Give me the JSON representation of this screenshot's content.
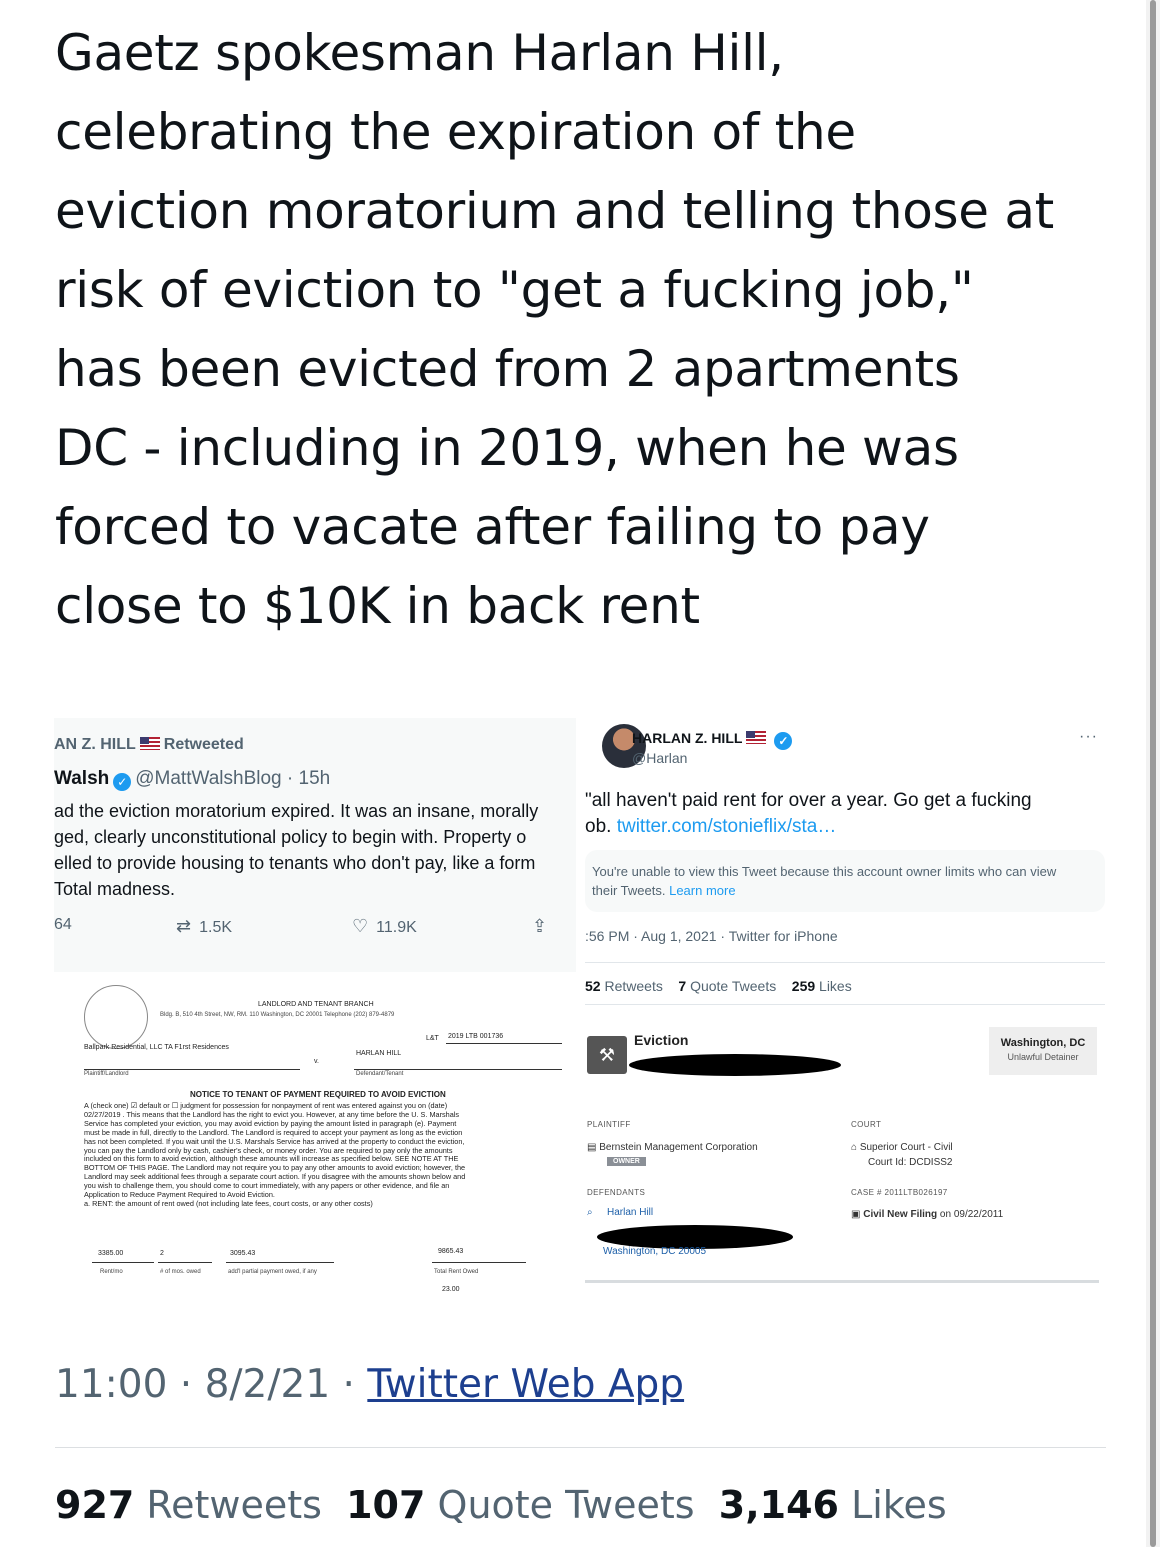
{
  "tweet": {
    "lines": [
      "Gaetz spokesman Harlan Hill,",
      "celebrating the expiration of the",
      "eviction moratorium and telling those at",
      "risk of eviction to \"get a fucking job,\"",
      "has been evicted from 2 apartments",
      "DC - including in 2019, when he was",
      "forced to vacate after failing to pay",
      "close to $10K in back rent"
    ],
    "time": "11:00",
    "date": "8/2/21",
    "source": "Twitter Web App",
    "retweets_count": "927",
    "retweets_label": "Retweets",
    "quotes_count": "107",
    "quotes_label": "Quote Tweets",
    "likes_count": "3,146",
    "likes_label": "Likes"
  },
  "left_screenshot": {
    "retweet_by": "AN Z. HILL",
    "retweeted_label": "Retweeted",
    "author_name": "Walsh",
    "author_handle": "@MattWalshBlog",
    "author_time": "· 15h",
    "body": [
      "ad the eviction moratorium expired. It was an insane, morally",
      "ged, clearly unconstitutional policy to begin with. Property o",
      "elled to provide housing to tenants who don't pay, like a form",
      " Total madness."
    ],
    "replies": "64",
    "retweets": "1.5K",
    "likes": "11.9K"
  },
  "document": {
    "branch": "LANDLORD AND TENANT BRANCH",
    "address": "Bldg. B, 510 4th Street, NW, RM. 110 Washington, DC 20001 Telephone (202) 879-4879",
    "case_prefix": "L&T",
    "case_no": "2019 LTB 001736",
    "plaintiff": "Ballpark Residential, LLC TA F1rst Residences",
    "versus": "v.",
    "defendant": "HARLAN HILL",
    "plaintiff_label": "Plaintiff/Landlord",
    "defendant_label": "Defendant/Tenant",
    "notice_title": "NOTICE TO TENANT OF PAYMENT REQUIRED TO AVOID EVICTION",
    "paragraph": [
      "A (check one) ☑ default  or  ☐ judgment for possession  for nonpayment of rent was entered against you on (date)",
      "02/27/2019 . This means that the Landlord has the right to evict you. However, at any time before the U. S. Marshals",
      "Service has completed your eviction, you may avoid eviction by paying the amount listed in paragraph (e). Payment",
      "must be made in full, directly to the Landlord. The Landlord is required to accept your payment as long as the eviction",
      "has not been completed. If you wait until the U.S. Marshals Service has arrived at the property to conduct the eviction,",
      "you can pay the Landlord only by cash, cashier's check, or money order. You are required to pay only the amounts",
      "included on this form to avoid eviction, although these amounts will increase as specified below. SEE NOTE AT THE",
      "BOTTOM OF THIS PAGE. The Landlord may not require you to pay any other amounts to avoid eviction; however, the",
      "Landlord may seek additional fees through a separate court action. If you disagree with the amounts shown below and",
      "you wish to challenge them, you should come to court immediately, with any papers or other evidence, and file an",
      "Application to Reduce Payment Required to Avoid Eviction.",
      "a.   RENT: the amount of rent owed (not including late fees, court costs, or any other costs)"
    ],
    "rent_mo": "3385.00",
    "months": "2",
    "partial": "3095.43",
    "total": "9865.43",
    "rent_mo_label": "Rent/mo",
    "months_label": "# of mos. owed",
    "partial_label": "add'l partial payment owed, if any",
    "total_label": "Total Rent Owed",
    "next_value": "23.00"
  },
  "right_screenshot": {
    "name": "HARLAN Z. HILL",
    "handle": "@Harlan",
    "more": "···",
    "text_line1": "\"all haven't paid rent for over a year. Go get a fucking",
    "text_line2_prefix": "ob.",
    "text_link": "twitter.com/stonieflix/sta…",
    "unavailable_text": "You're unable to view this Tweet because this account owner limits who can view their Tweets.",
    "learn_more": "Learn more",
    "meta": ":56 PM · Aug 1, 2021 · Twitter for iPhone",
    "retweets_count": "52",
    "retweets_label": "Retweets",
    "quotes_count": "7",
    "quotes_label": "Quote Tweets",
    "likes_count": "259",
    "likes_label": "Likes"
  },
  "case_record": {
    "title": "Eviction",
    "court_name": "Washington, DC",
    "court_type": "Unlawful Detainer",
    "plaintiff_label": "PLAINTIFF",
    "plaintiff": "Bernstein Management Corporation",
    "owner_badge": "OWNER",
    "court_label": "COURT",
    "court": "Superior Court - Civil",
    "court_id": "Court Id: DCDISS2",
    "defendants_label": "DEFENDANTS",
    "case_number": "CASE # 2011LTB026197",
    "defendant": "Harlan Hill",
    "filing": "Civil New Filing",
    "filing_date": "on 09/22/2011",
    "defendant_city": "Washington, DC 20005"
  }
}
